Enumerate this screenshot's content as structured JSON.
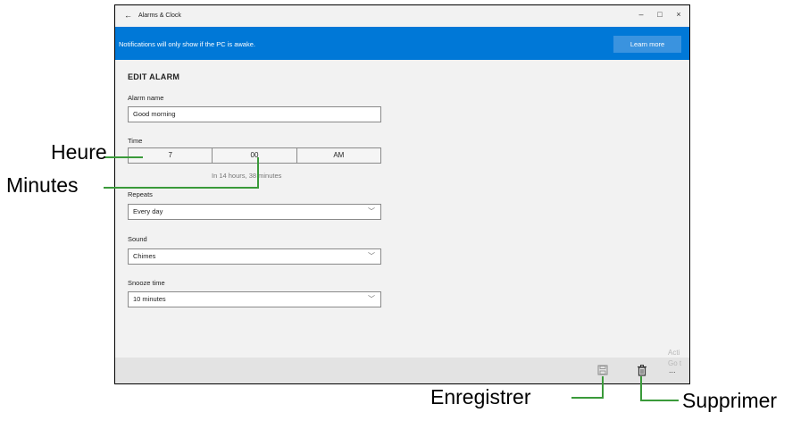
{
  "window": {
    "back_glyph": "←",
    "title": "Alarms & Clock",
    "minimize_glyph": "–",
    "maximize_glyph": "□",
    "close_glyph": "×"
  },
  "banner": {
    "text": "Notifications will only show if the PC is awake.",
    "learn_more": "Learn more",
    "color": "#0078d7"
  },
  "form": {
    "heading": "EDIT ALARM",
    "alarm_name_label": "Alarm name",
    "alarm_name_value": "Good morning",
    "time_label": "Time",
    "hour": "7",
    "minute": "00",
    "period": "AM",
    "time_hint": "In 14 hours, 38 minutes",
    "repeats_label": "Repeats",
    "repeats_value": "Every day",
    "sound_label": "Sound",
    "sound_value": "Chimes",
    "snooze_label": "Snooze time",
    "snooze_value": "10 minutes",
    "chevron_glyph": "﹀"
  },
  "bottombar": {
    "save_icon": "save-icon",
    "delete_icon": "trash-icon",
    "more_glyph": "...",
    "watermark_line1": "Acti",
    "watermark_line2": "Go t"
  },
  "callouts": {
    "heure": "Heure",
    "minutes": "Minutes",
    "enregistrer": "Enregistrer",
    "supprimer": "Supprimer",
    "line_color": "#3a9a3a"
  }
}
